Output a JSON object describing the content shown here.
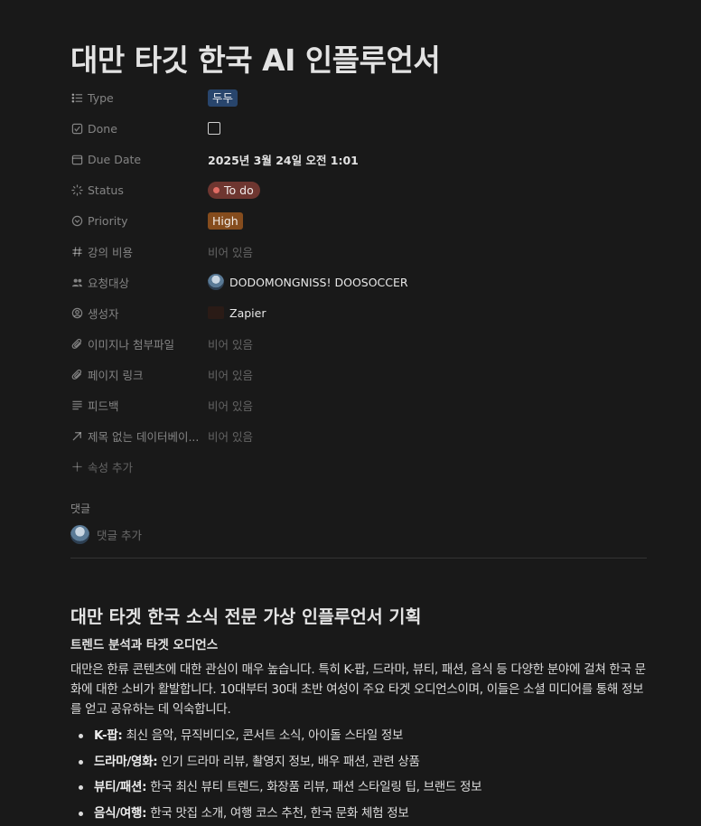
{
  "title": "대만 타깃 한국 AI 인플루언서",
  "properties": {
    "type": {
      "name": "Type",
      "value": "두두",
      "icon": "list-icon"
    },
    "done": {
      "name": "Done",
      "icon": "checkbox-icon",
      "checked": false
    },
    "due_date": {
      "name": "Due Date",
      "value": "2025년 3월 24일 오전 1:01",
      "icon": "calendar-icon"
    },
    "status": {
      "name": "Status",
      "value": "To do",
      "icon": "status-icon"
    },
    "priority": {
      "name": "Priority",
      "value": "High",
      "icon": "priority-icon"
    },
    "fee": {
      "name": "강의 비용",
      "value": "비어 있음",
      "icon": "hash-icon"
    },
    "requester": {
      "name": "요청대상",
      "value": "DODOMONGNISS! DOOSOCCER",
      "icon": "people-icon"
    },
    "creator": {
      "name": "생성자",
      "value": "Zapier",
      "icon": "user-circle-icon"
    },
    "images": {
      "name": "이미지나 첨부파일",
      "value": "비어 있음",
      "icon": "paperclip-icon"
    },
    "page_link": {
      "name": "페이지 링크",
      "value": "비어 있음",
      "icon": "paperclip-icon"
    },
    "feedback": {
      "name": "피드백",
      "value": "비어 있음",
      "icon": "text-lines-icon"
    },
    "relation": {
      "name": "제목 없는 데이터베이...",
      "value": "비어 있음",
      "icon": "arrow-up-right-icon"
    },
    "add_property": "속성 추가"
  },
  "comments": {
    "label": "댓글",
    "add_placeholder": "댓글 추가"
  },
  "content": {
    "heading": "대만 타겟 한국 소식 전문 가상 인플루언서 기획",
    "subheading": "트렌드 분석과 타겟 오디언스",
    "paragraph": "대만은 한류 콘텐츠에 대한 관심이 매우 높습니다. 특히 K-팝, 드라마, 뷰티, 패션, 음식 등 다양한 분야에 걸쳐 한국 문화에 대한 소비가 활발합니다. 10대부터 30대 초반 여성이 주요 타겟 오디언스이며, 이들은 소셜 미디어를 통해 정보를 얻고 공유하는 데 익숙합니다.",
    "bullets": [
      {
        "label": "K-팝:",
        "text": " 최신 음악, 뮤직비디오, 콘서트 소식, 아이돌 스타일 정보"
      },
      {
        "label": "드라마/영화:",
        "text": " 인기 드라마 리뷰, 촬영지 정보, 배우 패션, 관련 상품"
      },
      {
        "label": "뷰티/패션:",
        "text": " 한국 최신 뷰티 트렌드, 화장품 리뷰, 패션 스타일링 팁, 브랜드 정보"
      },
      {
        "label": "음식/여행:",
        "text": " 한국 맛집 소개, 여행 코스 추천, 한국 문화 체험 정보"
      }
    ]
  },
  "colors": {
    "background": "#191919",
    "type_tag": "#28456c",
    "priority_tag": "#854c1d",
    "status_pill": "#6e3630",
    "status_dot": "#e06c64"
  }
}
